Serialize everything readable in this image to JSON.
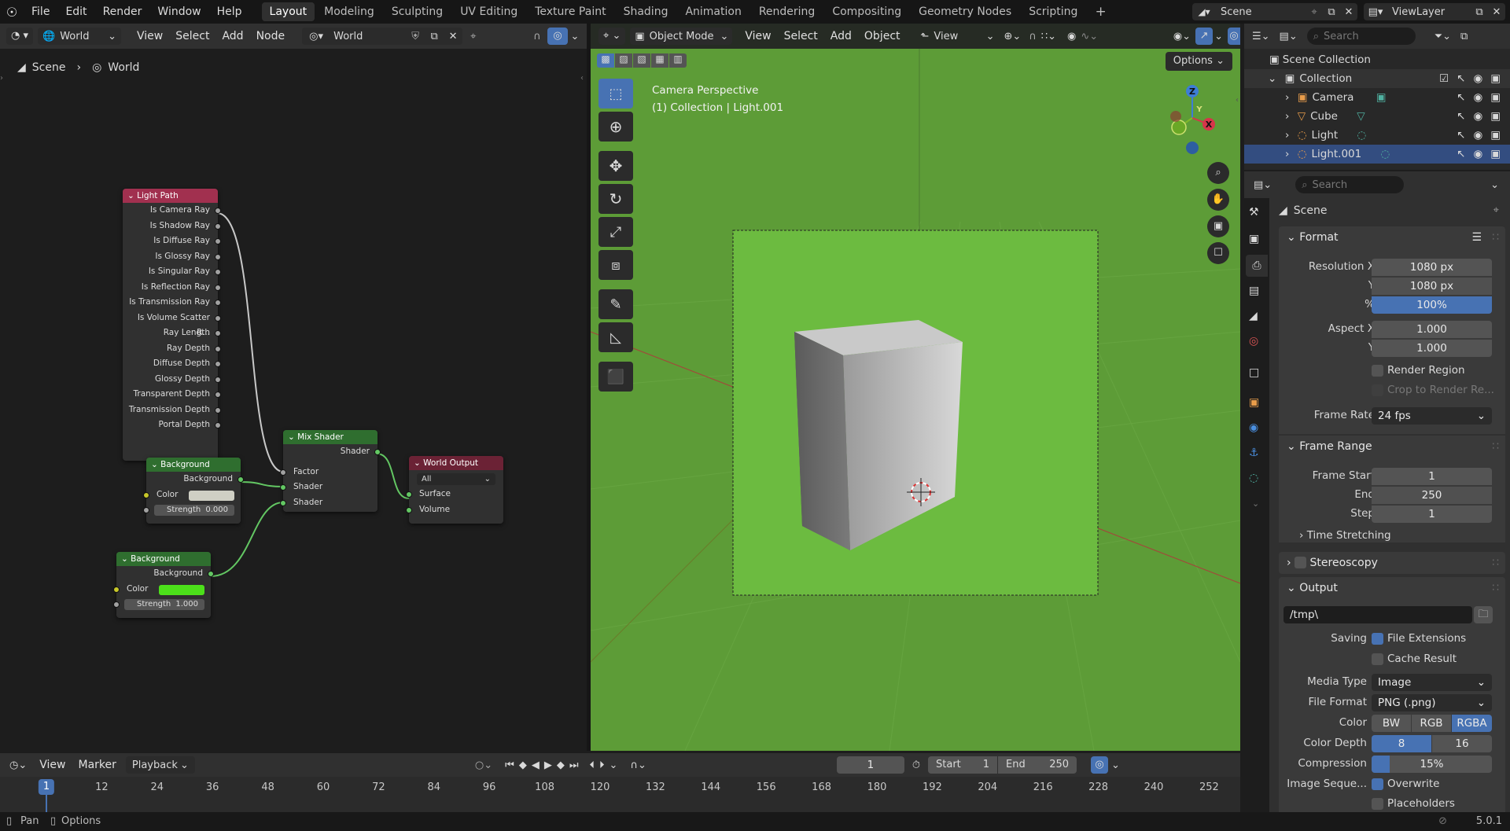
{
  "topbar": {
    "menus": [
      "File",
      "Edit",
      "Render",
      "Window",
      "Help"
    ],
    "workspaces": [
      "Layout",
      "Modeling",
      "Sculpting",
      "UV Editing",
      "Texture Paint",
      "Shading",
      "Animation",
      "Rendering",
      "Compositing",
      "Geometry Nodes",
      "Scripting"
    ],
    "active_workspace": "Layout",
    "add_workspace": "+",
    "scene": "Scene",
    "view_layer": "ViewLayer"
  },
  "node_editor": {
    "world_type": "World",
    "menus": [
      "View",
      "Select",
      "Add",
      "Node"
    ],
    "datablock": "World",
    "breadcrumb": [
      "Scene",
      "World"
    ],
    "nodes": {
      "light_path": {
        "title": "Light Path",
        "outputs": [
          "Is Camera Ray",
          "Is Shadow Ray",
          "Is Diffuse Ray",
          "Is Glossy Ray",
          "Is Singular Ray",
          "Is Reflection Ray",
          "Is Transmission Ray",
          "Is Volume Scatter R...",
          "Ray Length",
          "Ray Depth",
          "Diffuse Depth",
          "Glossy Depth",
          "Transparent Depth",
          "Transmission Depth",
          "Portal Depth"
        ]
      },
      "background_1": {
        "title": "Background",
        "output": "Background",
        "color_label": "Color",
        "color": "#cfcfc4",
        "strength_label": "Strength",
        "strength": "0.000"
      },
      "background_2": {
        "title": "Background",
        "output": "Background",
        "color_label": "Color",
        "color": "#4ce01a",
        "strength_label": "Strength",
        "strength": "1.000"
      },
      "mix_shader": {
        "title": "Mix Shader",
        "output": "Shader",
        "inputs": [
          "Factor",
          "Shader",
          "Shader"
        ]
      },
      "world_output": {
        "title": "World Output",
        "target": "All",
        "inputs": [
          "Surface",
          "Volume"
        ]
      }
    }
  },
  "viewport": {
    "mode": "Object Mode",
    "menus": [
      "View",
      "Select",
      "Add",
      "Object"
    ],
    "orientation": "View",
    "options": "Options",
    "overlay_line1": "Camera Perspective",
    "overlay_line2": "(1) Collection | Light.001",
    "gizmo": {
      "x": "X",
      "y": "Y",
      "z": "Z"
    },
    "world_color": "#5d9c37"
  },
  "outliner": {
    "search_placeholder": "Search",
    "root": "Scene Collection",
    "collection": "Collection",
    "items": [
      "Camera",
      "Cube",
      "Light",
      "Light.001"
    ]
  },
  "properties": {
    "search_placeholder": "Search",
    "context": "Scene",
    "format": {
      "title": "Format",
      "res_x_label": "Resolution X",
      "res_x": "1080 px",
      "res_y_label": "Y",
      "res_y": "1080 px",
      "pct_label": "%",
      "pct": "100%",
      "aspect_x_label": "Aspect X",
      "aspect_x": "1.000",
      "aspect_y_label": "Y",
      "aspect_y": "1.000",
      "render_region": "Render Region",
      "crop": "Crop to Render Re...",
      "frame_rate_label": "Frame Rate",
      "frame_rate": "24 fps"
    },
    "frame_range": {
      "title": "Frame Range",
      "start_label": "Frame Start",
      "start": "1",
      "end_label": "End",
      "end": "250",
      "step_label": "Step",
      "step": "1",
      "time_stretching": "Time Stretching"
    },
    "stereoscopy": "Stereoscopy",
    "output": {
      "title": "Output",
      "path": "/tmp\\",
      "saving_label": "Saving",
      "file_extensions": "File Extensions",
      "cache_result": "Cache Result",
      "media_type_label": "Media Type",
      "media_type": "Image",
      "file_format_label": "File Format",
      "file_format": "PNG (.png)",
      "color_label": "Color",
      "color_opts": [
        "BW",
        "RGB",
        "RGBA"
      ],
      "color_active": "RGBA",
      "depth_label": "Color Depth",
      "depth_opts": [
        "8",
        "16"
      ],
      "depth_active": "8",
      "compression_label": "Compression",
      "compression": "15%",
      "compression_value": 0.15,
      "image_seq_label": "Image Seque...",
      "overwrite": "Overwrite",
      "placeholders": "Placeholders"
    }
  },
  "timeline": {
    "menus": [
      "View",
      "Marker",
      "Playback"
    ],
    "current_frame": "1",
    "start_label": "Start",
    "start": "1",
    "end_label": "End",
    "end": "250",
    "ruler": [
      "1",
      "12",
      "24",
      "36",
      "48",
      "60",
      "72",
      "84",
      "96",
      "108",
      "120",
      "132",
      "144",
      "156",
      "168",
      "180",
      "192",
      "204",
      "216",
      "228",
      "240",
      "252"
    ]
  },
  "status": {
    "pan": "Pan",
    "options": "Options",
    "version": "5.0.1"
  }
}
